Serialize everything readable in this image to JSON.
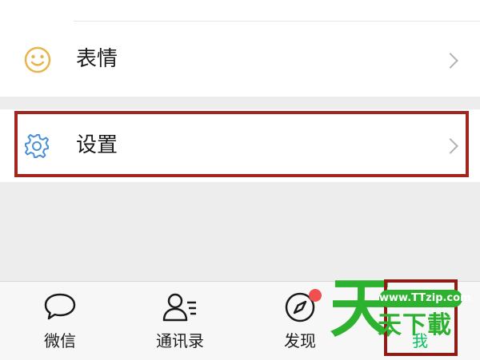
{
  "menu": {
    "emoji_label": "表情",
    "settings_label": "设置"
  },
  "tabbar": {
    "tabs": [
      {
        "label": "微信"
      },
      {
        "label": "通讯录"
      },
      {
        "label": "发现"
      },
      {
        "label": "我"
      }
    ]
  },
  "watermark": {
    "big_glyph": "天",
    "url": "www.TTzip.com",
    "text": "天下載"
  },
  "colors": {
    "emoji_icon": "#e8b44b",
    "settings_icon": "#4a90d9",
    "highlight_box": "#a3261e",
    "badge": "#f0504f",
    "watermark": "#2db22f",
    "active_tab": "#07c160"
  },
  "icons": {
    "emoji": "smile-icon",
    "settings": "gear-icon",
    "chats": "chat-bubble-icon",
    "contacts": "contacts-icon",
    "discover": "compass-icon"
  }
}
